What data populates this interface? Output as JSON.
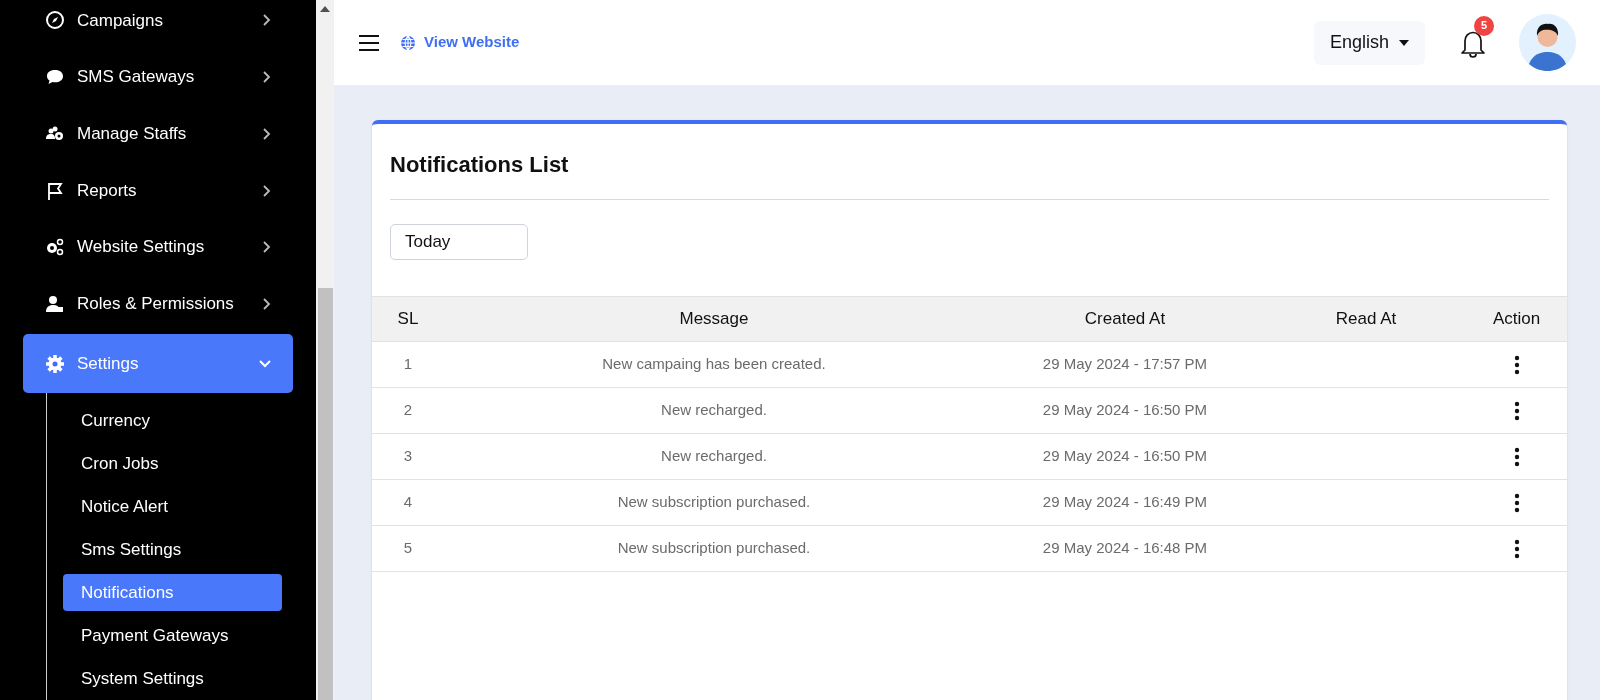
{
  "sidebar": {
    "items": [
      {
        "label": "Campaigns",
        "expanded": false
      },
      {
        "label": "SMS Gateways",
        "expanded": false
      },
      {
        "label": "Manage Staffs",
        "expanded": false
      },
      {
        "label": "Reports",
        "expanded": false
      },
      {
        "label": "Website Settings",
        "expanded": false
      },
      {
        "label": "Roles & Permissions",
        "expanded": false
      },
      {
        "label": "Settings",
        "expanded": true,
        "children": [
          {
            "label": "Currency",
            "selected": false
          },
          {
            "label": "Cron Jobs",
            "selected": false
          },
          {
            "label": "Notice Alert",
            "selected": false
          },
          {
            "label": "Sms Settings",
            "selected": false
          },
          {
            "label": "Notifications",
            "selected": true
          },
          {
            "label": "Payment Gateways",
            "selected": false
          },
          {
            "label": "System Settings",
            "selected": false
          }
        ]
      }
    ]
  },
  "header": {
    "view_website": "View Website",
    "language": "English",
    "notification_count": "5"
  },
  "card": {
    "title": "Notifications List",
    "filter": "Today",
    "table": {
      "columns": [
        "SL",
        "Message",
        "Created At",
        "Read At",
        "Action"
      ],
      "rows": [
        {
          "sl": "1",
          "message": "New campaing has been created.",
          "created_at": "29 May 2024 - 17:57 PM"
        },
        {
          "sl": "2",
          "message": "New recharged.",
          "created_at": "29 May 2024 - 16:50 PM"
        },
        {
          "sl": "3",
          "message": "New recharged.",
          "created_at": "29 May 2024 - 16:50 PM"
        },
        {
          "sl": "4",
          "message": "New subscription purchased.",
          "created_at": "29 May 2024 - 16:49 PM"
        },
        {
          "sl": "5",
          "message": "New subscription purchased.",
          "created_at": "29 May 2024 - 16:48 PM"
        }
      ]
    }
  }
}
